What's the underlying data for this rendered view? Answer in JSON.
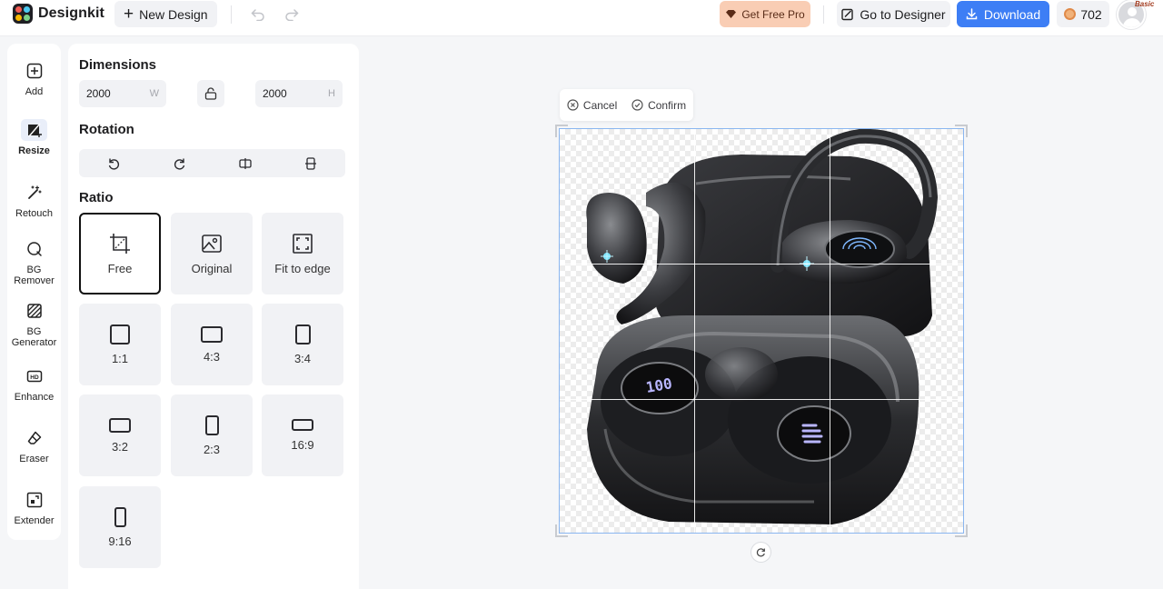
{
  "app": {
    "name": "Designkit",
    "new_design_label": "New Design",
    "get_pro_label": "Get Free Pro",
    "go_to_designer_label": "Go to Designer",
    "download_label": "Download",
    "credits": "702",
    "plan_badge": "Basic",
    "logo_colors": [
      "#f25c54",
      "#4cc9f0",
      "#f7b801",
      "#7bd389"
    ]
  },
  "rail": {
    "items": [
      {
        "label": "Add",
        "icon": "add-square-icon",
        "active": false
      },
      {
        "label": "Resize",
        "icon": "crop-resize-icon",
        "active": true
      },
      {
        "label": "Retouch",
        "icon": "magic-wand-icon",
        "active": false
      },
      {
        "label": "BG\nRemover",
        "icon": "bg-remover-icon",
        "active": false
      },
      {
        "label": "BG\nGenerator",
        "icon": "bg-generator-icon",
        "active": false
      },
      {
        "label": "Enhance",
        "icon": "hd-icon",
        "active": false
      },
      {
        "label": "Eraser",
        "icon": "eraser-icon",
        "active": false
      },
      {
        "label": "Extender",
        "icon": "extender-icon",
        "active": false
      }
    ]
  },
  "panel": {
    "dimensions_title": "Dimensions",
    "width_value": "2000",
    "width_unit": "W",
    "height_value": "2000",
    "height_unit": "H",
    "rotation_title": "Rotation",
    "ratio_title": "Ratio",
    "ratios": [
      {
        "label": "Free",
        "icon": "free-crop-icon",
        "selected": true
      },
      {
        "label": "Original",
        "icon": "image-icon",
        "selected": false
      },
      {
        "label": "Fit to edge",
        "icon": "fit-edge-icon",
        "selected": false
      },
      {
        "label": "1:1",
        "selected": false
      },
      {
        "label": "4:3",
        "selected": false
      },
      {
        "label": "3:4",
        "selected": false
      },
      {
        "label": "3:2",
        "selected": false
      },
      {
        "label": "2:3",
        "selected": false
      },
      {
        "label": "16:9",
        "selected": false
      },
      {
        "label": "9:16",
        "selected": false
      }
    ]
  },
  "canvas": {
    "cancel_label": "Cancel",
    "confirm_label": "Confirm",
    "accent": "#3d7ef5"
  }
}
